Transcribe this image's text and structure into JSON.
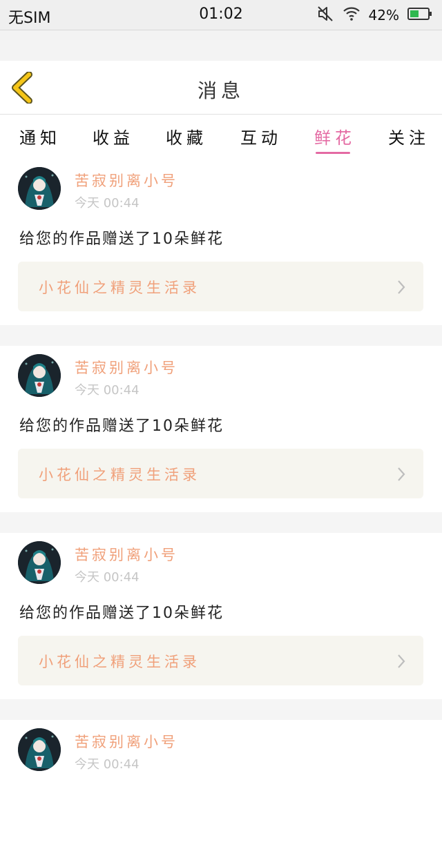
{
  "status_bar": {
    "carrier": "无SIM",
    "time": "01:02",
    "battery_percent": "42%",
    "icons": [
      "mute-icon",
      "wifi-icon",
      "battery-icon"
    ],
    "battery_color": "#2fb84f"
  },
  "header": {
    "title": "消息",
    "back_icon": "chevron-left-icon",
    "back_color": "#f5c518"
  },
  "tabs": [
    {
      "label": "通知",
      "active": false
    },
    {
      "label": "收益",
      "active": false
    },
    {
      "label": "收藏",
      "active": false
    },
    {
      "label": "互动",
      "active": false
    },
    {
      "label": "鲜花",
      "active": true
    },
    {
      "label": "关注",
      "active": false
    }
  ],
  "colors": {
    "accent": "#e46aa3",
    "username": "#f0a07a",
    "timestamp": "#c6c6c6"
  },
  "feed": [
    {
      "username": "苦寂别离小号",
      "time": "今天 00:44",
      "message": "给您的作品赠送了10朵鲜花",
      "work_title": "小花仙之精灵生活录"
    },
    {
      "username": "苦寂别离小号",
      "time": "今天 00:44",
      "message": "给您的作品赠送了10朵鲜花",
      "work_title": "小花仙之精灵生活录"
    },
    {
      "username": "苦寂别离小号",
      "time": "今天 00:44",
      "message": "给您的作品赠送了10朵鲜花",
      "work_title": "小花仙之精灵生活录"
    },
    {
      "username": "苦寂别离小号",
      "time": "今天 00:44"
    }
  ]
}
